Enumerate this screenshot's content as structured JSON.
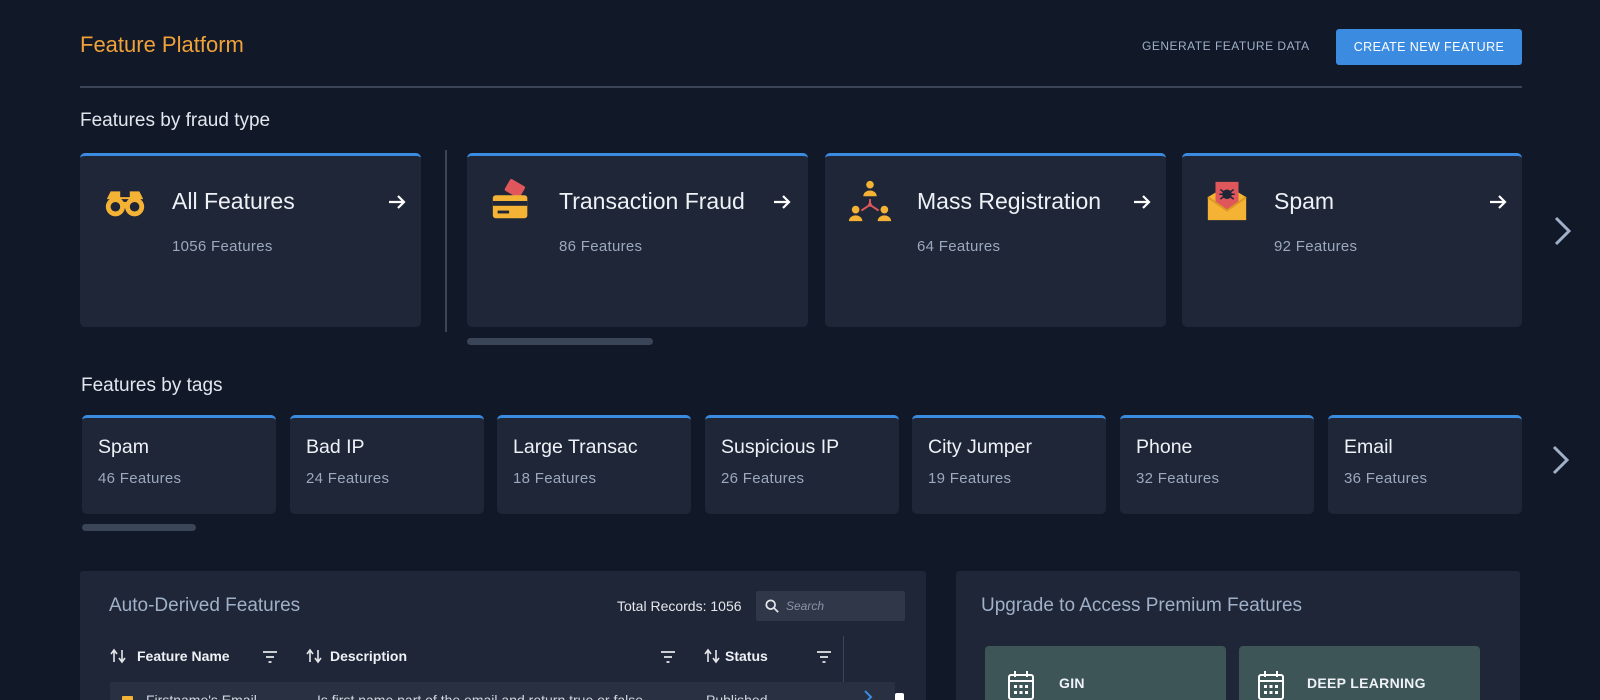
{
  "header": {
    "title": "Feature Platform",
    "generate_label": "GENERATE FEATURE DATA",
    "create_label": "CREATE NEW FEATURE"
  },
  "fraud_section": {
    "title": "Features by fraud type",
    "cards": [
      {
        "title": "All Features",
        "count": "1056 Features",
        "icon": "binoculars-icon"
      },
      {
        "title": "Transaction Fraud",
        "count": "86 Features",
        "icon": "credit-card-icon"
      },
      {
        "title": "Mass Registration",
        "count": "64 Features",
        "icon": "people-network-icon"
      },
      {
        "title": "Spam",
        "count": "92 Features",
        "icon": "spam-mail-icon"
      }
    ]
  },
  "tags_section": {
    "title": "Features by tags",
    "cards": [
      {
        "title": "Spam",
        "count": "46 Features"
      },
      {
        "title": "Bad IP",
        "count": "24 Features"
      },
      {
        "title": "Large Transac",
        "count": "18 Features"
      },
      {
        "title": "Suspicious IP",
        "count": "26 Features"
      },
      {
        "title": "City Jumper",
        "count": "19 Features"
      },
      {
        "title": "Phone",
        "count": "32 Features"
      },
      {
        "title": "Email",
        "count": "36 Features"
      }
    ]
  },
  "table": {
    "title": "Auto-Derived Features",
    "total_records": "Total Records: 1056",
    "search_placeholder": "Search",
    "columns": [
      "Feature Name",
      "Description",
      "Status"
    ],
    "rows": [
      {
        "name": "Firstname's Email",
        "description": "Is first name part of the email and return true or false",
        "status": "Published"
      }
    ]
  },
  "upgrade": {
    "title": "Upgrade to Access Premium Features",
    "cards": [
      {
        "title": "GIN",
        "icon": "calendar-icon"
      },
      {
        "title": "DEEP LEARNING",
        "icon": "calendar-icon"
      }
    ]
  },
  "colors": {
    "background": "#111827",
    "card": "#1f2637",
    "accent": "#3b8be0",
    "title": "#f0a13a",
    "icon": "#f5b335"
  }
}
